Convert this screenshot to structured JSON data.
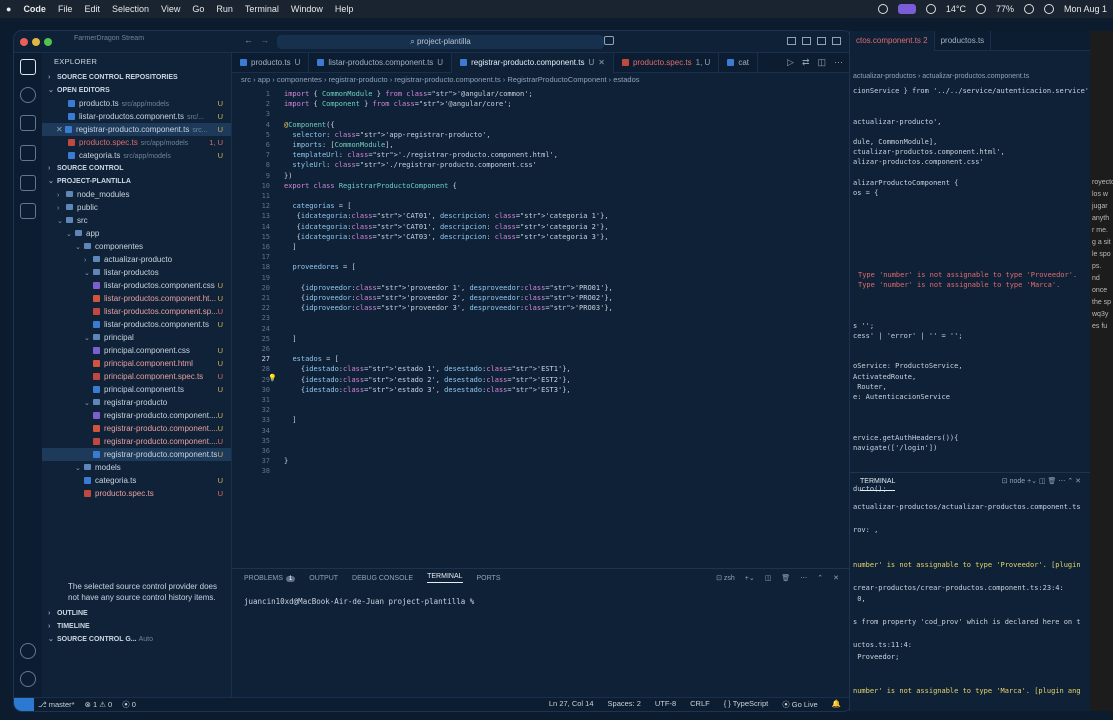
{
  "menubar": {
    "app": "Code",
    "items": [
      "File",
      "Edit",
      "Selection",
      "View",
      "Go",
      "Run",
      "Terminal",
      "Window",
      "Help"
    ],
    "temp": "14°C",
    "battery": "77%",
    "date": "Mon Aug 1"
  },
  "window": {
    "title_left": "FarmerDragon Stream",
    "search": "project-plantilla"
  },
  "sidebar": {
    "title": "EXPLORER",
    "sc_repos": "SOURCE CONTROL REPOSITORIES",
    "open_editors": "OPEN EDITORS",
    "editors": [
      {
        "name": "producto.ts",
        "hint": "src/app/models",
        "status": "U",
        "type": "ts"
      },
      {
        "name": "listar-productos.component.ts",
        "hint": "src/...",
        "status": "U",
        "type": "ts"
      },
      {
        "name": "registrar-producto.component.ts",
        "hint": "src...",
        "status": "U",
        "type": "ts"
      },
      {
        "name": "producto.spec.ts",
        "hint": "src/app/models",
        "status": "1, U",
        "type": "spec"
      },
      {
        "name": "categoria.ts",
        "hint": "src/app/models",
        "status": "U",
        "type": "ts"
      }
    ],
    "source_control": "SOURCE CONTROL",
    "project": "PROJECT-PLANTILLA",
    "tree": [
      {
        "label": "node_modules",
        "indent": 1,
        "kind": "folder"
      },
      {
        "label": "public",
        "indent": 1,
        "kind": "folder"
      },
      {
        "label": "src",
        "indent": 1,
        "kind": "folder-open"
      },
      {
        "label": "app",
        "indent": 2,
        "kind": "folder-open"
      },
      {
        "label": "componentes",
        "indent": 3,
        "kind": "folder-open"
      },
      {
        "label": "actualizar-producto",
        "indent": 4,
        "kind": "folder"
      },
      {
        "label": "listar-productos",
        "indent": 4,
        "kind": "folder-open"
      },
      {
        "label": "listar-productos.component.css",
        "indent": 5,
        "kind": "css",
        "status": "U"
      },
      {
        "label": "listar-productos.component.ht...",
        "indent": 5,
        "kind": "html",
        "status": "U"
      },
      {
        "label": "listar-productos.component.sp...",
        "indent": 5,
        "kind": "spec",
        "status": "U"
      },
      {
        "label": "listar-productos.component.ts",
        "indent": 5,
        "kind": "ts",
        "status": "U"
      },
      {
        "label": "principal",
        "indent": 4,
        "kind": "folder-open"
      },
      {
        "label": "principal.component.css",
        "indent": 5,
        "kind": "css",
        "status": "U"
      },
      {
        "label": "principal.component.html",
        "indent": 5,
        "kind": "html",
        "status": "U"
      },
      {
        "label": "principal.component.spec.ts",
        "indent": 5,
        "kind": "spec",
        "status": "U"
      },
      {
        "label": "principal.component.ts",
        "indent": 5,
        "kind": "ts",
        "status": "U"
      },
      {
        "label": "registrar-producto",
        "indent": 4,
        "kind": "folder-open"
      },
      {
        "label": "registrar-producto.component....",
        "indent": 5,
        "kind": "css",
        "status": "U"
      },
      {
        "label": "registrar-producto.component....",
        "indent": 5,
        "kind": "html",
        "status": "U"
      },
      {
        "label": "registrar-producto.component....",
        "indent": 5,
        "kind": "spec",
        "status": "U"
      },
      {
        "label": "registrar-producto.component.ts",
        "indent": 5,
        "kind": "ts",
        "status": "U",
        "selected": true
      },
      {
        "label": "models",
        "indent": 3,
        "kind": "folder-open"
      },
      {
        "label": "categoria.ts",
        "indent": 4,
        "kind": "ts",
        "status": "U"
      },
      {
        "label": "producto.spec.ts",
        "indent": 4,
        "kind": "spec",
        "status": "U"
      }
    ],
    "outline": "OUTLINE",
    "timeline": "TIMELINE",
    "sc_graph": "SOURCE CONTROL G...",
    "sc_auto": "Auto",
    "sc_message": "The selected source control provider does not have any source control history items."
  },
  "tabs": [
    {
      "name": "producto.ts",
      "status": "U"
    },
    {
      "name": "listar-productos.component.ts",
      "status": "U"
    },
    {
      "name": "registrar-producto.component.ts",
      "status": "U",
      "active": true
    },
    {
      "name": "producto.spec.ts",
      "status": "1, U"
    },
    {
      "name": "cat",
      "status": ""
    }
  ],
  "breadcrumb": "src › app › componentes › registrar-producto › registrar-producto.component.ts › RegistrarProductoComponent › estados",
  "code": [
    "import { CommonModule } from '@angular/common';",
    "import { Component } from '@angular/core';",
    "",
    "@Component({",
    "  selector: 'app-registrar-producto',",
    "  imports: [CommonModule],",
    "  templateUrl: './registrar-producto.component.html',",
    "  styleUrl: './registrar-producto.component.css'",
    "})",
    "export class RegistrarProductoComponent {",
    "",
    "  categorias = [",
    "   {idcategoria:'CAT01', descripcion: 'categoria 1'},",
    "   {idcategoria:'CAT01', descripcion: 'categoria 2'},",
    "   {idcategoria:'CAT03', descripcion: 'categoria 3'},",
    "  ]",
    "",
    "  proveedores = [",
    "",
    "    {idproveedor:'proveedor 1', desproveedor:'PRO01'},",
    "    {idproveedor:'proveedor 2', desproveedor:'PRO02'},",
    "    {idproveedor:'proveedor 3', desproveedor:'PRO03'},",
    "",
    "",
    "  ]",
    "",
    "  estados = [",
    "    {idestado:'estado 1', desestado:'EST1'},",
    "    {idestado:'estado 2', desestado:'EST2'},",
    "    {idestado:'estado 3', desestado:'EST3'},",
    "",
    "",
    "  ]",
    "",
    "",
    "",
    "}",
    ""
  ],
  "panel": {
    "tabs": [
      "PROBLEMS",
      "OUTPUT",
      "DEBUG CONSOLE",
      "TERMINAL",
      "PORTS"
    ],
    "problems_count": "1",
    "shell": "zsh",
    "prompt": "juancin10xd@MacBook-Air-de-Juan project-plantilla %"
  },
  "status": {
    "branch": "master*",
    "errors": "1",
    "warnings": "0",
    "ports": "0",
    "position": "Ln 27, Col 14",
    "spaces": "Spaces: 2",
    "encoding": "UTF-8",
    "eol": "CRLF",
    "lang": "TypeScript",
    "golive": "Go Live"
  },
  "right_window": {
    "tabs": [
      "ctos.component.ts 2",
      "productos.ts"
    ],
    "crumb": "actualizar-productos › actualizar-productos.component.ts",
    "lines": [
      "cionService } from '../../service/autenticacion.service';",
      "",
      "",
      "actualizar-producto',",
      "",
      "dule, CommonModule],",
      "ctualizar-productos.component.html',",
      "alizar-productos.component.css'",
      "",
      "alizarProductoComponent {",
      "os = {",
      "",
      "",
      "",
      "",
      "",
      "",
      "",
      "Type 'number' is not assignable to type 'Proveedor'.",
      "Type 'number' is not assignable to type 'Marca'.",
      "",
      "",
      "",
      "s '';",
      "cess' | 'error' | '' = '';",
      "",
      "",
      "oService: ProductoService,",
      "ActivatedRoute,",
      " Router,",
      "e: AutenticacionService",
      "",
      "",
      "",
      "ervice.getAuthHeaders()){",
      "navigate(['/login'])",
      "",
      "",
      "",
      "ducto();"
    ],
    "terminal_label": "TERMINAL",
    "terminal_shell": "node",
    "term": [
      {
        "t": "actualizar-productos/actualizar-productos.component.ts",
        "c": ""
      },
      {
        "t": "",
        "c": ""
      },
      {
        "t": "rov: ,",
        "c": ""
      },
      {
        "t": "",
        "c": ""
      },
      {
        "t": "",
        "c": ""
      },
      {
        "t": "number' is not assignable to type 'Proveedor'. [plugin",
        "c": "yel"
      },
      {
        "t": "",
        "c": ""
      },
      {
        "t": "crear-productos/crear-productos.component.ts:23:4:",
        "c": ""
      },
      {
        "t": " 0,",
        "c": ""
      },
      {
        "t": "",
        "c": ""
      },
      {
        "t": "s from property 'cod_prov' which is declared here on t",
        "c": ""
      },
      {
        "t": "",
        "c": ""
      },
      {
        "t": "uctos.ts:11:4:",
        "c": ""
      },
      {
        "t": " Proveedor;",
        "c": ""
      },
      {
        "t": "",
        "c": ""
      },
      {
        "t": "",
        "c": ""
      },
      {
        "t": "number' is not assignable to type 'Marca'. [plugin ang",
        "c": "yel"
      }
    ]
  },
  "strip": [
    "royecto",
    "los w",
    "jugar",
    "anyth",
    "r me.",
    "g a sit",
    "le spo",
    "ps.",
    "nd",
    "once",
    "the sp",
    "wq3y",
    "es fu"
  ],
  "colors": {
    "accent": "#2b79d0",
    "modified": "#d2b25a",
    "error": "#e06c6c"
  }
}
